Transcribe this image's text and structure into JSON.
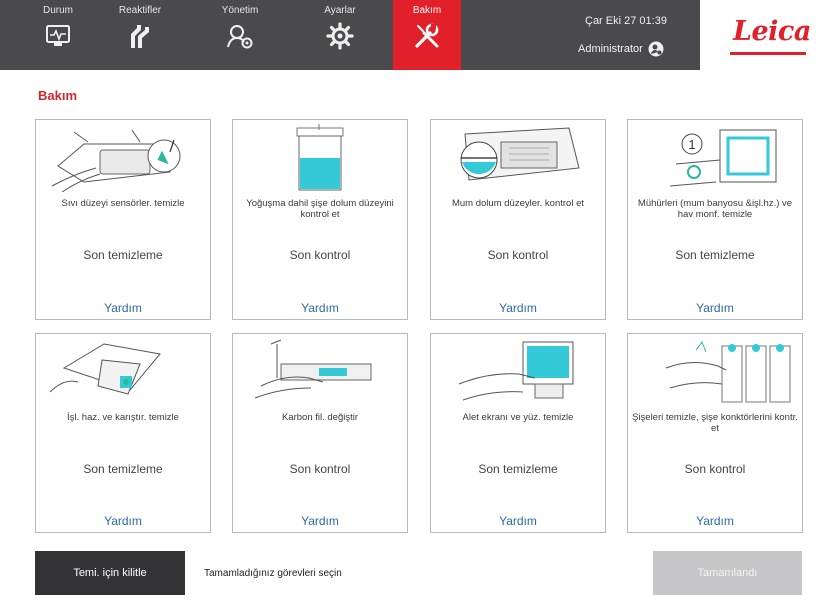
{
  "nav": {
    "tabs": [
      {
        "label": "Durum",
        "icon": "monitor-pulse-icon"
      },
      {
        "label": "Reaktifler",
        "icon": "reagent-bottles-icon"
      },
      {
        "label": "Yönetim",
        "icon": "user-admin-icon"
      },
      {
        "label": "Ayarlar",
        "icon": "gear-icon"
      },
      {
        "label": "Bakım",
        "icon": "wrench-screwdriver-icon",
        "active": true
      }
    ],
    "datetime": "Çar Eki 27 01:39",
    "user": "Administrator",
    "logo": "Leica"
  },
  "page": {
    "title": "Bakım"
  },
  "cards": [
    {
      "task": "Sıvı düzeyi sensörler. temizle",
      "status": "Son temizleme",
      "help": "Yardım",
      "illustration": "liquid-level-sensor-illustration"
    },
    {
      "task": "Yoğuşma dahil şişe dolum düzeyini kontrol et",
      "status": "Son kontrol",
      "help": "Yardım",
      "illustration": "condensate-bottle-illustration"
    },
    {
      "task": "Mum dolum düzeyler. kontrol et",
      "status": "Son kontrol",
      "help": "Yardım",
      "illustration": "wax-fill-level-illustration"
    },
    {
      "task": "Mühürleri (mum banyosu &işl.hz.) ve hav monf. temizle",
      "status": "Son temizleme",
      "help": "Yardım",
      "illustration": "seals-cleaning-illustration"
    },
    {
      "task": "İşl. haz. ve karıştır. temizle",
      "status": "Son temizleme",
      "help": "Yardım",
      "illustration": "retort-stirrer-illustration"
    },
    {
      "task": "Karbon fil. değiştir",
      "status": "Son kontrol",
      "help": "Yardım",
      "illustration": "carbon-filter-illustration"
    },
    {
      "task": "Alet ekranı ve yüz. temizle",
      "status": "Son temizleme",
      "help": "Yardım",
      "illustration": "screen-cleaning-illustration"
    },
    {
      "task": "Şişeleri temizle, şişe konktörlerini kontr. et",
      "status": "Son kontrol",
      "help": "Yardım",
      "illustration": "bottle-connectors-illustration"
    }
  ],
  "footer": {
    "lock_label": "Temi. için kilitle",
    "hint": "Tamamladığınız görevleri seçin",
    "done_label": "Tamamlandı"
  },
  "colors": {
    "brand": "#e2202a",
    "nav_bg": "#4a4a4d",
    "link": "#2a6aac",
    "title": "#d4262e",
    "accent_teal": "#33c9d6"
  }
}
